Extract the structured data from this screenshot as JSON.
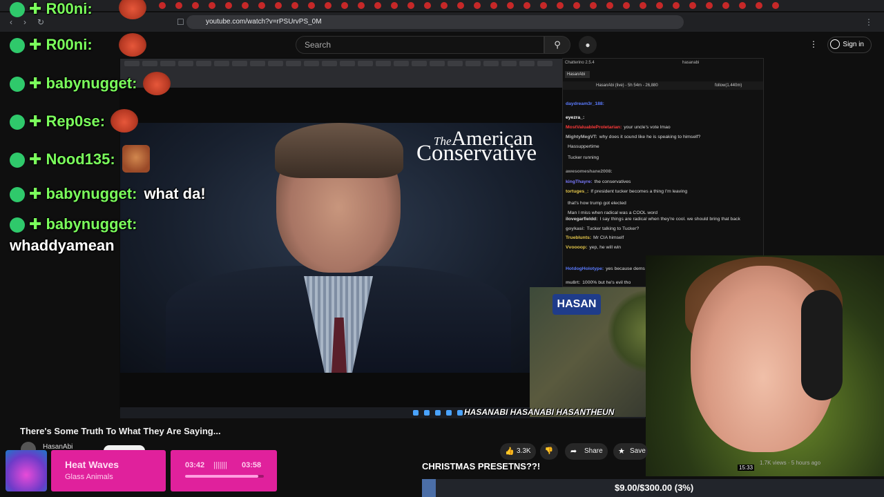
{
  "browser": {
    "url": "youtube.com/watch?v=rPSUrvPS_0M"
  },
  "youtube": {
    "search_placeholder": "Search",
    "sign_in": "Sign in",
    "video_title": "There's Some Truth To What They Are Saying...",
    "channel": "HasanAbi",
    "likes": "3.3K",
    "share": "Share",
    "save": "Save"
  },
  "video": {
    "brand_line1_prefix": "The",
    "brand_line1": "American",
    "brand_line2": "Conservative"
  },
  "chatterino": {
    "title": "Chatterino 2.5.4",
    "title_channel": "hasanabi",
    "tab": "HasanAbi",
    "header": "HasanAbi (live) - 5h 54m - 26,880",
    "header_right": "follow(1.440m)",
    "messages": [
      {
        "user": "daydream3r_188:",
        "text": "",
        "color": "#5b7bff"
      },
      {
        "user": "eyezra_:",
        "text": "",
        "color": "#fff"
      },
      {
        "user": "MostValuableProletarian:",
        "text": "your uncle's vote lmao",
        "color": "#ff3a3a"
      },
      {
        "user": "MightyMegVT:",
        "text": "why does it sound like he is speaking to himself?",
        "color": "#b9b9b9"
      },
      {
        "user": "",
        "text": "Hassuppertime",
        "color": "#ff3a3a"
      },
      {
        "user": "",
        "text": "Tucker running",
        "color": "#ff3a3a"
      },
      {
        "user": "awesomeshane2008:",
        "text": "",
        "color": "#999"
      },
      {
        "user": "kingThayre:",
        "text": "the conservatives",
        "color": "#7b7bff"
      },
      {
        "user": "tortuges_:",
        "text": "If president tucker becomes a thing I'm leaving",
        "color": "#e6c84b"
      },
      {
        "user": "",
        "text": "that's how trump got elected",
        "color": "#ff3a3a"
      },
      {
        "user": "",
        "text": "Man I miss when radical was a COOL word",
        "color": "#ff3a3a"
      },
      {
        "user": "ilovegarfieldd:",
        "text": "I say things are radical when they're cool. we should bring that back",
        "color": "#ddd"
      },
      {
        "user": "goykasi:",
        "text": "Tucker talking to Tucker?",
        "color": "#aaa"
      },
      {
        "user": "Trueblunts:",
        "text": "Mr CIA himself",
        "color": "#e6c84b"
      },
      {
        "user": "Vvoooop:",
        "text": "yep, he will win",
        "color": "#e6c84b"
      },
      {
        "user": "",
        "text": "",
        "color": "#ff3a3a"
      },
      {
        "user": "HotdogHolotype:",
        "text": "yes because dems are useless fucking perpetu",
        "color": "#5b7bff"
      },
      {
        "user": "mu8rt:",
        "text": "1000% but he's evil tho",
        "color": "#aaa"
      }
    ]
  },
  "overlay_chat": [
    {
      "user": "R00ni:",
      "text": ""
    },
    {
      "user": "R00ni:",
      "text": ""
    },
    {
      "user": "babynugget:",
      "text": ""
    },
    {
      "user": "Rep0se:",
      "text": ""
    },
    {
      "user": "Nood135:",
      "text": ""
    },
    {
      "user": "babynugget:",
      "text": "what da!"
    },
    {
      "user": "babynugget:",
      "text": ""
    },
    {
      "user": "",
      "text": "whaddyamean"
    }
  ],
  "now_playing": {
    "song": "Heat Waves",
    "artist": "Glass Animals",
    "elapsed": "03:42",
    "duration": "03:58",
    "progress": 0.93
  },
  "stream": {
    "socials": "HASANABI  HASANABI  HASANTHEUN",
    "cam_label": "HASAN",
    "marquee": "CHRISTMAS PRESETNS??!",
    "goal": "$9.00/$300.00 (3%)",
    "goal_fraction": 0.03,
    "views": "1.7K views · 5 hours ago",
    "duration": "15:33"
  }
}
